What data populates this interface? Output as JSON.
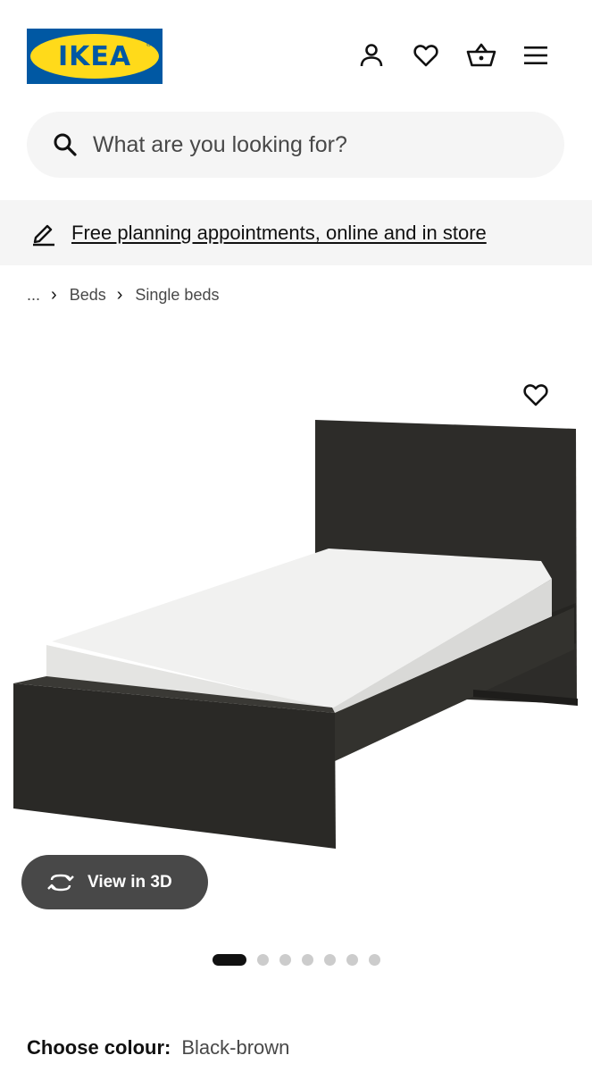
{
  "header": {
    "logo_text": "IKEA",
    "logo_mark": "®",
    "icons": [
      "person-icon",
      "heart-icon",
      "basket-icon",
      "menu-icon"
    ]
  },
  "search": {
    "placeholder": "What are you looking for?"
  },
  "banner": {
    "link_text": "Free planning appointments, online and in store"
  },
  "breadcrumb": {
    "items": [
      "...",
      "Beds",
      "Single beds"
    ]
  },
  "gallery": {
    "view3d_label": "View in 3D",
    "image_count": 7,
    "active_index": 0
  },
  "colour": {
    "label": "Choose colour:",
    "value": "Black-brown"
  },
  "colors": {
    "ikea_blue": "#0058a3",
    "ikea_yellow": "#ffda1a",
    "bed_frame": "#2b2a27",
    "mattress": "#f1f1f0"
  }
}
